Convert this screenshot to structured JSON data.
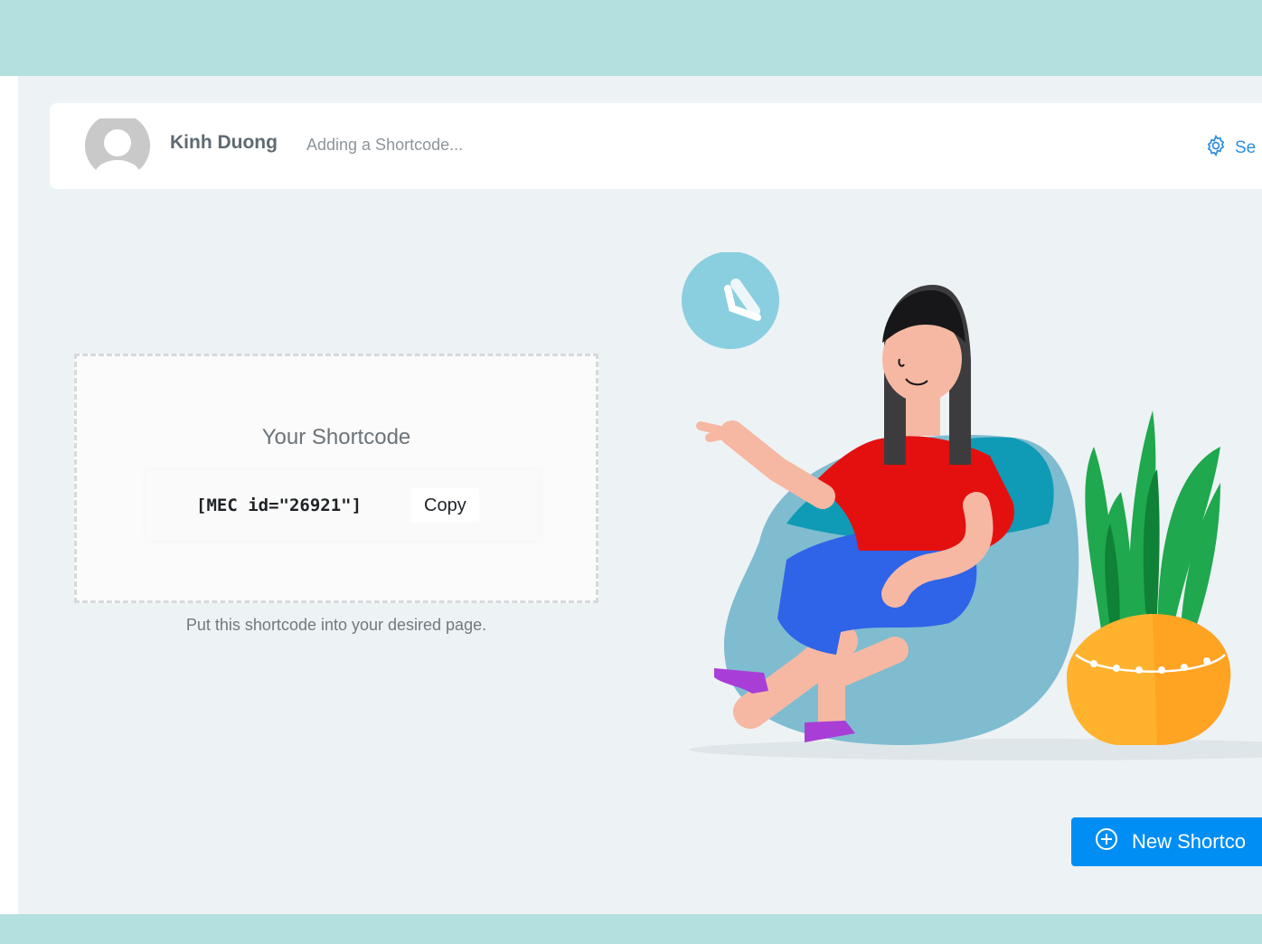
{
  "header": {
    "user_name": "Kinh Duong",
    "status": "Adding a Shortcode...",
    "settings_label": "Se"
  },
  "shortcode": {
    "title": "Your Shortcode",
    "code": "[MEC id=\"26921\"]",
    "copy_label": "Copy",
    "hint": "Put this shortcode into your desired page."
  },
  "actions": {
    "new_shortcode_label": "New Shortco"
  },
  "icons": {
    "avatar": "user-avatar-placeholder",
    "settings": "gear-icon",
    "add": "plus-circle-icon",
    "clock": "clock-icon"
  },
  "colors": {
    "accent": "#008ef5",
    "outer_background": "#b4e0df",
    "panel_background": "#edf2f5",
    "link": "#2d8de0"
  }
}
